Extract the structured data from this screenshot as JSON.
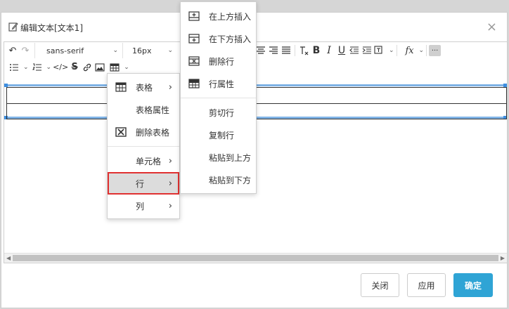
{
  "dialog": {
    "title": "编辑文本[文本1]",
    "close": "×"
  },
  "toolbar": {
    "undo": "↶",
    "redo": "↷",
    "font_family": "sans-serif",
    "font_size": "16px",
    "chevron": "⌄",
    "bold": "B",
    "italic": "I",
    "underline": "U",
    "formula": "fx",
    "more": "···",
    "strike": "S",
    "code": "</>"
  },
  "context_menu": {
    "items": [
      {
        "label": "表格",
        "has_submenu": true
      },
      {
        "label": "表格属性",
        "has_submenu": false
      },
      {
        "label": "删除表格",
        "has_submenu": false
      },
      {
        "label": "单元格",
        "has_submenu": true
      },
      {
        "label": "行",
        "has_submenu": true,
        "active": true
      },
      {
        "label": "列",
        "has_submenu": true
      }
    ],
    "arrow": "›"
  },
  "row_submenu": {
    "items": [
      {
        "label": "在上方插入"
      },
      {
        "label": "在下方插入"
      },
      {
        "label": "删除行"
      },
      {
        "label": "行属性"
      },
      {
        "label": "剪切行"
      },
      {
        "label": "复制行"
      },
      {
        "label": "粘贴到上方"
      },
      {
        "label": "粘贴到下方"
      }
    ]
  },
  "footer": {
    "close_label": "关闭",
    "apply_label": "应用",
    "ok_label": "确定"
  },
  "colors": {
    "primary": "#2fa4d5",
    "highlight_border": "#e03131",
    "selection": "#3d8ee0"
  }
}
